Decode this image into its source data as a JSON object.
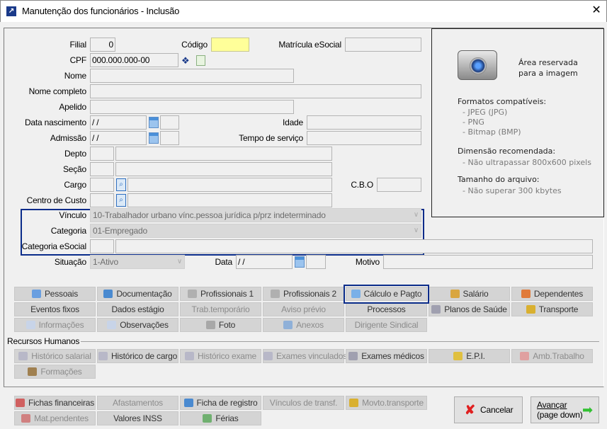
{
  "window": {
    "title": "Manutenção dos funcionários - Inclusão",
    "close": "✕"
  },
  "form": {
    "filial_label": "Filial",
    "filial_value": "0",
    "codigo_label": "Código",
    "codigo_value": "",
    "matricula_label": "Matrícula eSocial",
    "matricula_value": "",
    "cpf_label": "CPF",
    "cpf_value": "000.000.000-00",
    "nome_label": "Nome",
    "nome_completo_label": "Nome completo",
    "apelido_label": "Apelido",
    "data_nasc_label": "Data nascimento",
    "data_nasc_value": " /  /",
    "idade_label": "Idade",
    "admissao_label": "Admissão",
    "admissao_value": " /  /",
    "tempo_label": "Tempo de serviço",
    "depto_label": "Depto",
    "secao_label": "Seção",
    "cargo_label": "Cargo",
    "cbo_label": "C.B.O",
    "centro_label": "Centro de Custo",
    "vinculo_label": "Vínculo",
    "vinculo_value": "10-Trabalhador urbano vínc.pessoa jurídica p/prz indeterminado",
    "categoria_label": "Categoria",
    "categoria_value": "01-Empregado",
    "cat_esocial_label": "Categoria eSocial",
    "situacao_label": "Situação",
    "situacao_value": "1-Ativo",
    "data_label": "Data",
    "data_value": " /  /",
    "motivo_label": "Motivo"
  },
  "image_panel": {
    "reserved": "Área reservada",
    "reserved2": "para a imagem",
    "formats_title": "Formatos compatíveis:",
    "formats": [
      "- JPEG (JPG)",
      "- PNG",
      "- Bitmap (BMP)"
    ],
    "dim_title": "Dimensão recomendada:",
    "dim_value": "- Não ultrapassar 800x600 pixels",
    "size_title": "Tamanho do arquivo:",
    "size_value": "- Não superar 300 kbytes"
  },
  "tabs": [
    {
      "label": "Pessoais",
      "enabled": true,
      "icon": "person-icon",
      "color": "#6a9fe0"
    },
    {
      "label": "Documentação",
      "enabled": true,
      "icon": "id-card-icon",
      "color": "#4a8ad0"
    },
    {
      "label": "Profissionais 1",
      "enabled": true,
      "icon": "document-icon",
      "color": "#b0b0b0"
    },
    {
      "label": "Profissionais 2",
      "enabled": true,
      "icon": "document-icon",
      "color": "#b0b0b0"
    },
    {
      "label": "Cálculo e Pagto",
      "enabled": true,
      "icon": "calculator-icon",
      "color": "#7ab0e8"
    },
    {
      "label": "Salário",
      "enabled": true,
      "icon": "money-bag-icon",
      "color": "#d9a640"
    },
    {
      "label": "Dependentes",
      "enabled": true,
      "icon": "people-icon",
      "color": "#e07a3a"
    },
    {
      "label": "Eventos fixos",
      "enabled": true
    },
    {
      "label": "Dados estágio",
      "enabled": true
    },
    {
      "label": "Trab.temporário",
      "enabled": false
    },
    {
      "label": "Aviso prévio",
      "enabled": false
    },
    {
      "label": "Processos",
      "enabled": true
    },
    {
      "label": "Planos de Saúde",
      "enabled": true,
      "icon": "ambulance-icon",
      "color": "#a0a0b0"
    },
    {
      "label": "Transporte",
      "enabled": true,
      "icon": "bus-icon",
      "color": "#d9b030"
    },
    {
      "label": "Informações",
      "enabled": false,
      "icon": "page-icon",
      "color": "#c8d4e8"
    },
    {
      "label": "Observações",
      "enabled": true,
      "icon": "page-icon",
      "color": "#c8d4e8"
    },
    {
      "label": "Foto",
      "enabled": true,
      "icon": "camera-icon",
      "color": "#a8a8a8"
    },
    {
      "label": "Anexos",
      "enabled": false,
      "icon": "paperclip-icon",
      "color": "#8fb0d8"
    },
    {
      "label": "Dirigente Sindical",
      "enabled": false
    }
  ],
  "rh": {
    "title": "Recursos Humanos",
    "buttons": [
      {
        "label": "Histórico salarial",
        "enabled": false,
        "icon": "stethoscope-icon",
        "color": "#b8b8c8"
      },
      {
        "label": "Histórico de cargo",
        "enabled": true,
        "icon": "stethoscope-icon",
        "color": "#b8b8c8"
      },
      {
        "label": "Histórico exame",
        "enabled": false,
        "icon": "stethoscope-icon",
        "color": "#b8b8c8"
      },
      {
        "label": "Exames vinculados",
        "enabled": false,
        "icon": "stethoscope-icon",
        "color": "#b8b8c8"
      },
      {
        "label": "Exames médicos",
        "enabled": true,
        "icon": "ambulance-icon",
        "color": "#a0a0b0"
      },
      {
        "label": "E.P.I.",
        "enabled": true,
        "icon": "worker-icon",
        "color": "#e0c040"
      },
      {
        "label": "Amb.Trabalho",
        "enabled": false,
        "icon": "first-aid-icon",
        "color": "#e0a0a0"
      },
      {
        "label": "Formações",
        "enabled": false,
        "icon": "graduation-cap-icon",
        "color": "#a08050"
      }
    ]
  },
  "bottom": [
    {
      "label": "Fichas financeiras",
      "enabled": true,
      "icon": "ledger-icon",
      "color": "#d06060"
    },
    {
      "label": "Afastamentos",
      "enabled": false
    },
    {
      "label": "Ficha de registro",
      "enabled": true,
      "icon": "id-card-icon",
      "color": "#4a8ad0"
    },
    {
      "label": "Vínculos de transf.",
      "enabled": false
    },
    {
      "label": "Movto.transporte",
      "enabled": false,
      "icon": "bus-icon",
      "color": "#d9b030"
    },
    {
      "label": "Mat.pendentes",
      "enabled": false,
      "icon": "tools-icon",
      "color": "#d08080"
    },
    {
      "label": "Valores INSS",
      "enabled": true
    },
    {
      "label": "Férias",
      "enabled": true,
      "icon": "landscape-icon",
      "color": "#70b070"
    }
  ],
  "actions": {
    "cancel": "Cancelar",
    "next1": "Avançar",
    "next2": "(page down)"
  }
}
